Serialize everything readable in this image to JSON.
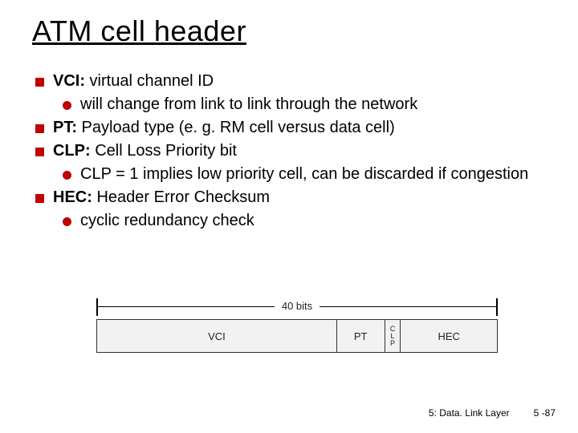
{
  "title": "ATM cell header",
  "bullets": {
    "b1_term": "VCI:",
    "b1_rest": " virtual channel ID",
    "b1_sub": "will change from link to link through the network",
    "b2_term": "PT:",
    "b2_rest": " Payload type (e. g. RM cell versus data cell)",
    "b3_term": "CLP:",
    "b3_rest": " Cell Loss Priority bit",
    "b3_sub": "CLP = 1 implies low priority cell, can be discarded if congestion",
    "b4_term": "HEC:",
    "b4_rest": " Header Error Checksum",
    "b4_sub": "cyclic redundancy check"
  },
  "diagram": {
    "bits_label": "40 bits",
    "fields": {
      "vci": "VCI",
      "pt": "PT",
      "clp_top": "C",
      "clp_mid": "L",
      "clp_bot": "P",
      "hec": "HEC"
    }
  },
  "footer": {
    "chapter": "5: Data. Link Layer",
    "page": "5 -87"
  }
}
